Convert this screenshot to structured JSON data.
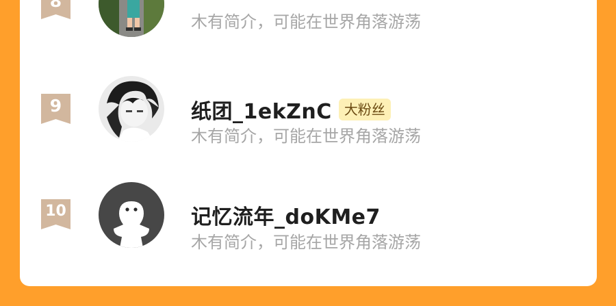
{
  "colors": {
    "page_background": "#ff9f2b",
    "card_background": "#ffffff",
    "rank_badge": "#d2b79e",
    "fan_badge_bg": "#fdf0b6",
    "fan_badge_text": "#6b4a12",
    "name_text": "#1f1f1f",
    "bio_text": "#a6a6a6"
  },
  "leaderboard": {
    "entries": [
      {
        "rank": "8",
        "name": "",
        "badge": "",
        "bio": "木有简介，可能在世界角落游荡",
        "avatar_icon": "child-on-road-photo-avatar"
      },
      {
        "rank": "9",
        "name": "纸团_1ekZnC",
        "badge": "大粉丝",
        "bio": "木有简介，可能在世界角落游荡",
        "avatar_icon": "anime-boy-photo-avatar"
      },
      {
        "rank": "10",
        "name": "记忆流年_doKMe7",
        "badge": "",
        "bio": "木有简介，可能在世界角落游荡",
        "avatar_icon": "default-ghost-avatar"
      }
    ]
  }
}
